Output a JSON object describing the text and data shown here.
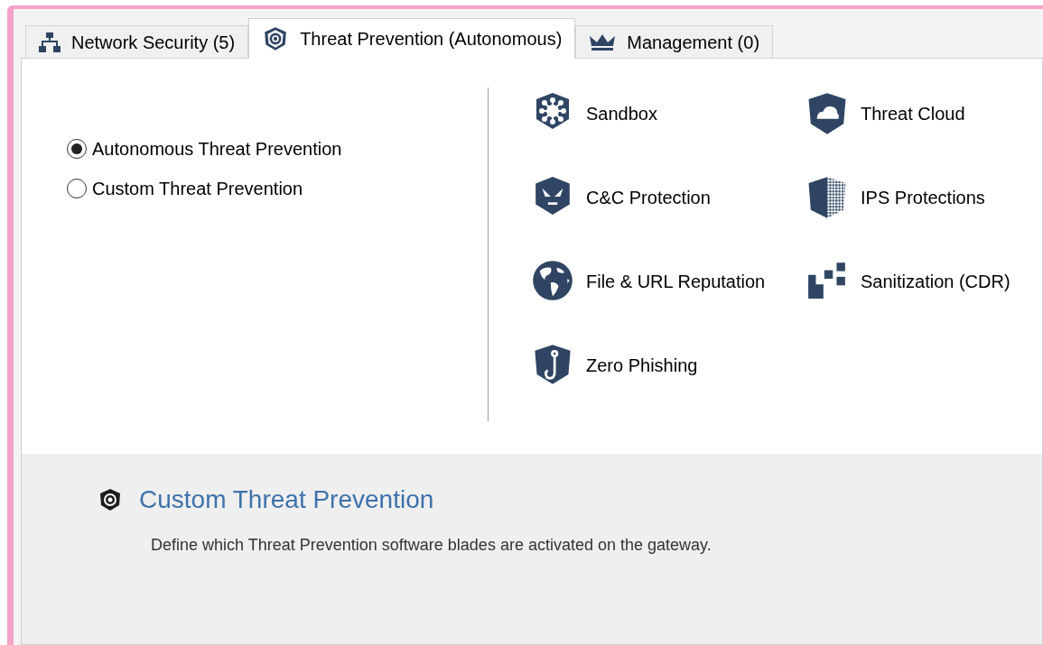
{
  "tabs": [
    {
      "label": "Network Security (5)",
      "kind": "network",
      "selected": false
    },
    {
      "label": "Threat Prevention (Autonomous)",
      "kind": "shield",
      "selected": true
    },
    {
      "label": "Management (0)",
      "kind": "crown",
      "selected": false
    }
  ],
  "mode_options": [
    {
      "label": "Autonomous Threat Prevention",
      "selected": true
    },
    {
      "label": "Custom Threat Prevention",
      "selected": false
    }
  ],
  "blades": [
    {
      "label": "Sandbox",
      "kind": "sandbox"
    },
    {
      "label": "Threat Cloud",
      "kind": "cloud"
    },
    {
      "label": "C&C Protection",
      "kind": "cnc"
    },
    {
      "label": "IPS Protections",
      "kind": "ips"
    },
    {
      "label": "File & URL Reputation",
      "kind": "globe"
    },
    {
      "label": "Sanitization (CDR)",
      "kind": "cdr"
    },
    {
      "label": "Zero Phishing",
      "kind": "phishing"
    }
  ],
  "info_panel": {
    "title": "Custom Threat Prevention",
    "description": "Define which Threat Prevention software blades are activated on the gateway."
  }
}
